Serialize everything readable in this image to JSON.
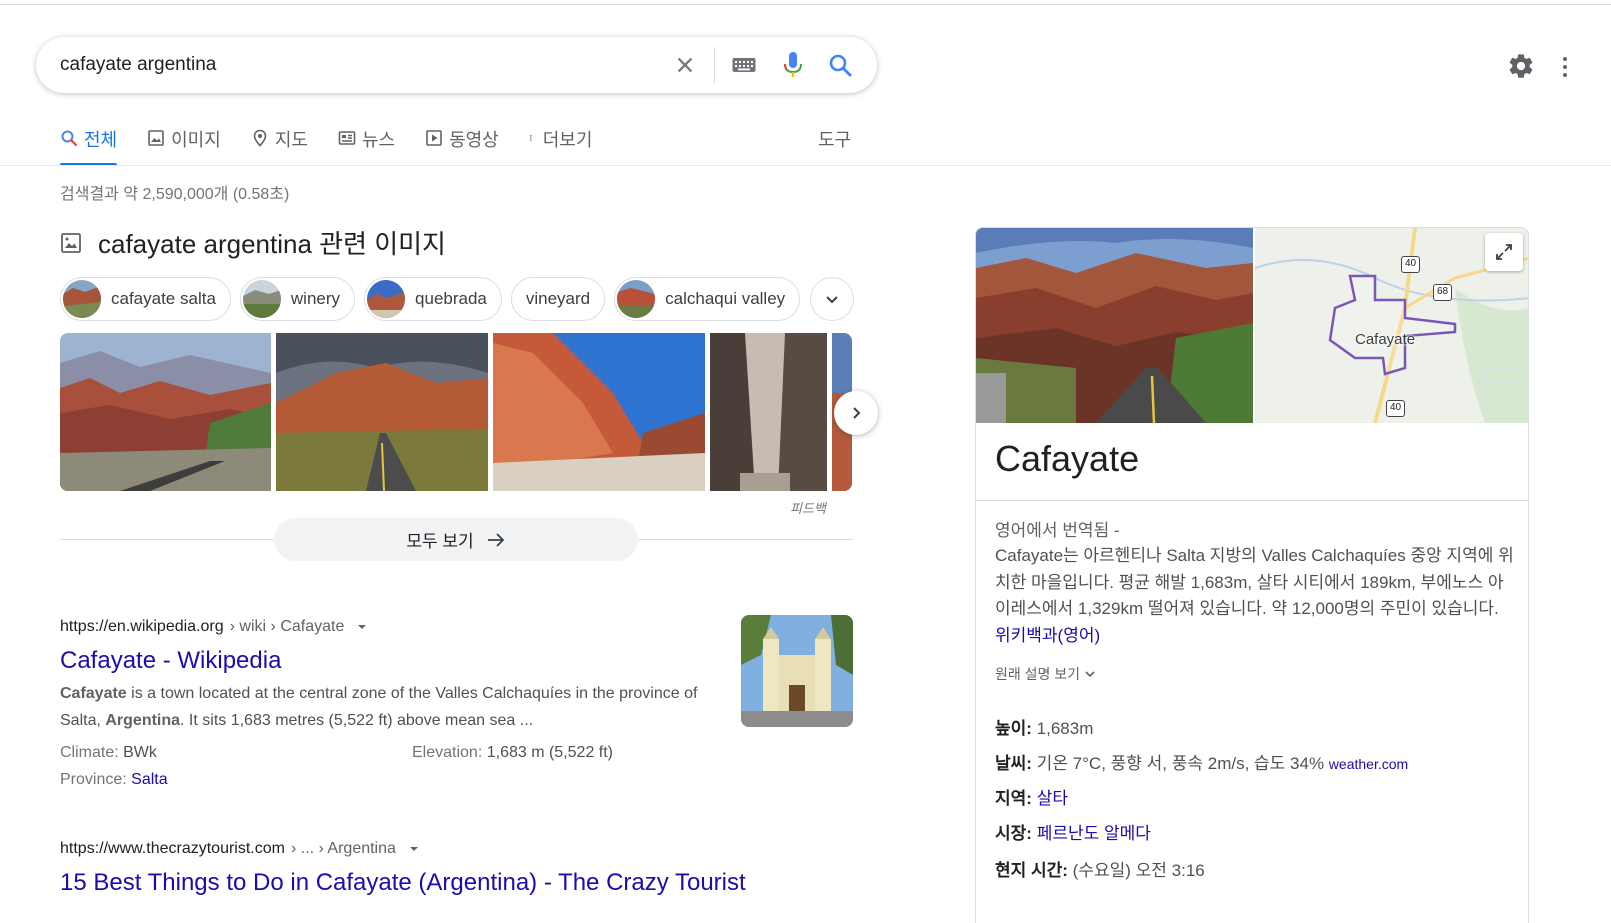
{
  "search": {
    "query": "cafayate argentina"
  },
  "tabs": [
    {
      "label": "전체",
      "icon": "search-icon"
    },
    {
      "label": "이미지",
      "icon": "image-icon"
    },
    {
      "label": "지도",
      "icon": "map-pin-icon"
    },
    {
      "label": "뉴스",
      "icon": "news-icon"
    },
    {
      "label": "동영상",
      "icon": "video-icon"
    },
    {
      "label": "더보기",
      "icon": "more-vert-icon"
    }
  ],
  "tools_label": "도구",
  "stats": "검색결과 약 2,590,000개 (0.58초)",
  "images": {
    "heading": "cafayate argentina 관련 이미지",
    "chips": [
      "cafayate salta",
      "winery",
      "quebrada",
      "vineyard",
      "calchaqui valley"
    ],
    "feedback": "피드백",
    "see_all": "모두 보기"
  },
  "results": [
    {
      "cite_domain": "https://en.wikipedia.org",
      "cite_path": " › wiki › Cafayate",
      "title": "Cafayate - Wikipedia",
      "snippet_b1": "Cafayate",
      "snippet_t1": " is a town located at the central zone of the Valles Calchaquíes in the province of Salta, ",
      "snippet_b2": "Argentina",
      "snippet_t2": ". It sits 1,683 metres (5,522 ft) above mean sea ...",
      "climate_label": "Climate: ",
      "climate_value": "BWk",
      "elevation_label": "Elevation: ",
      "elevation_value": "1,683 m (5,522 ft)",
      "province_label": "Province: ",
      "province_value": "Salta"
    },
    {
      "cite_domain": "https://www.thecrazytourist.com",
      "cite_path": " › ... › Argentina",
      "title": "15 Best Things to Do in Cafayate (Argentina) - The Crazy Tourist"
    }
  ],
  "knowledge_panel": {
    "title": "Cafayate",
    "map_label": "Cafayate",
    "route_40_top": "40",
    "route_68": "68",
    "route_40_bottom": "40",
    "translated_from": "영어에서 번역됨 -",
    "description": "Cafayate는 아르헨티나 Salta 지방의 Valles Calchaquíes 중앙 지역에 위치한 마을입니다. 평균 해발 1,683m, 살타 시티에서 189km, 부에노스 아이레스에서 1,329km 떨어져 있습니다. 약 12,000명의 주민이 있습니다. ",
    "source_link": "위키백과(영어)",
    "original_desc": "원래 설명 보기",
    "facts": {
      "elevation_label": "높이:",
      "elevation_value": " 1,683m",
      "weather_label": "날씨:",
      "weather_value": " 기온 7°C, 풍향 서, 풍속 2m/s, 습도 34% ",
      "weather_source": "weather.com",
      "region_label": "지역:",
      "region_value": "살타",
      "mayor_label": "시장:",
      "mayor_value": "페르난도 알메다",
      "time_label": "현지 시간:",
      "time_value": " (수요일) 오전 3:16"
    }
  },
  "colors": {
    "link": "#1a0dab",
    "accent": "#1a73e8",
    "muted": "#70757a"
  }
}
